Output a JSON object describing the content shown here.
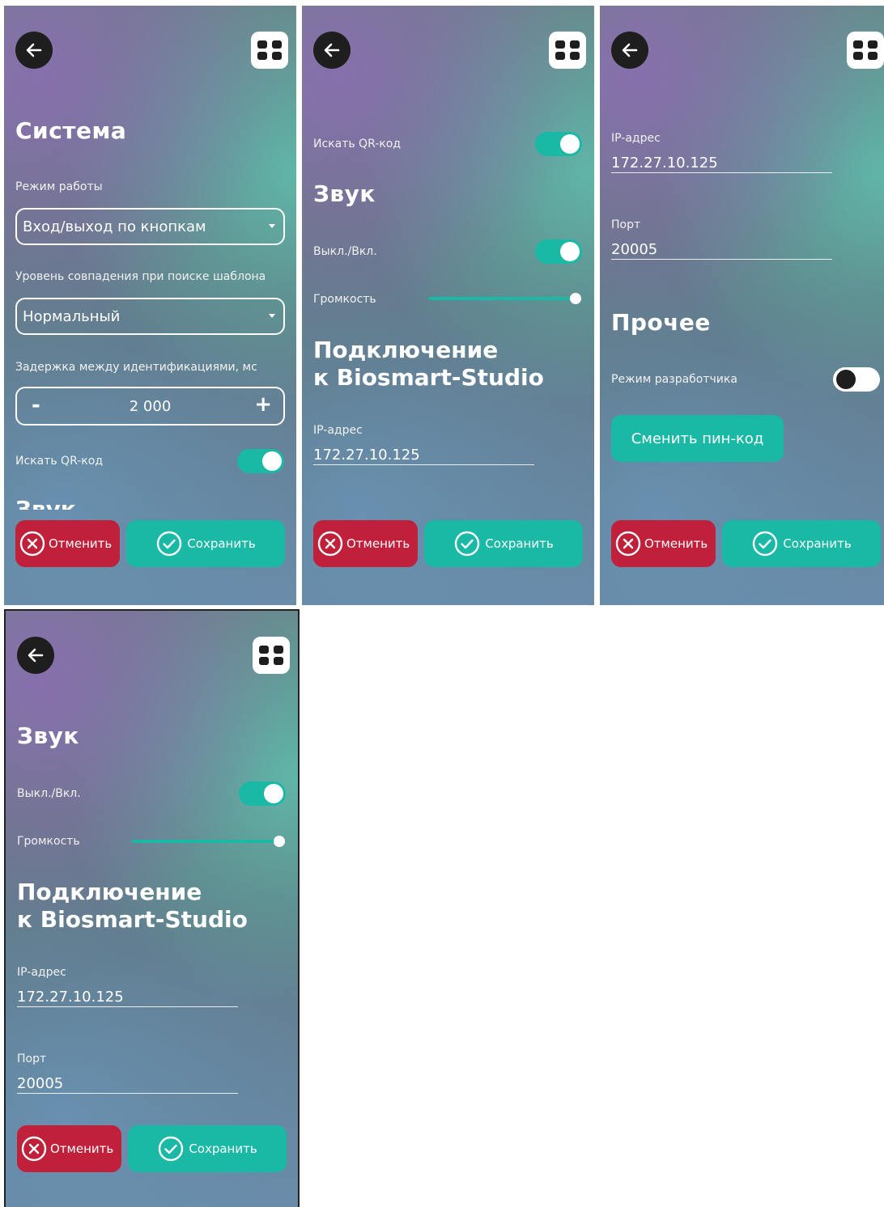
{
  "common": {
    "cancel_label": "Отменить",
    "save_label": "Сохранить",
    "accent_color": "#19b9a6",
    "cancel_color": "#c0203a",
    "back_icon": "arrow-left-icon",
    "menu_icon": "grid-menu-icon"
  },
  "screen1": {
    "title": "Система",
    "mode_label": "Режим работы",
    "mode_value": "Вход/выход по кнопкам",
    "match_label": "Уровень совпадения при поиске шаблона",
    "match_value": "Нормальный",
    "delay_label": "Задержка между идентификациями, мс",
    "delay_value": "2 000",
    "delay_minus": "-",
    "delay_plus": "+",
    "qr_label": "Искать QR-код",
    "qr_on": true,
    "clipped_heading": "Звук"
  },
  "screen2": {
    "qr_label": "Искать QR-код",
    "sound_title": "Звук",
    "sound_toggle_label": "Выкл./Вкл.",
    "volume_label": "Громкость",
    "volume_level": 1.0,
    "connection_title_line1": "Подключение",
    "connection_title_line2": "к Biosmart-Studio",
    "ip_label": "IP-адрес",
    "ip_value": "172.27.10.125"
  },
  "screen3": {
    "ip_label": "IP-адрес",
    "ip_value": "172.27.10.125",
    "port_label": "Порт",
    "port_value": "20005",
    "other_title": "Прочее",
    "dev_mode_label": "Режим разработчика",
    "dev_mode_on": false,
    "change_pin_label": "Сменить пин-код"
  },
  "screen4": {
    "sound_title": "Звук",
    "sound_toggle_label": "Выкл./Вкл.",
    "volume_label": "Громкость",
    "volume_level": 1.0,
    "connection_title_line1": "Подключение",
    "connection_title_line2": "к Biosmart-Studio",
    "ip_label": "IP-адрес",
    "ip_value": "172.27.10.125",
    "port_label": "Порт",
    "port_value": "20005"
  }
}
